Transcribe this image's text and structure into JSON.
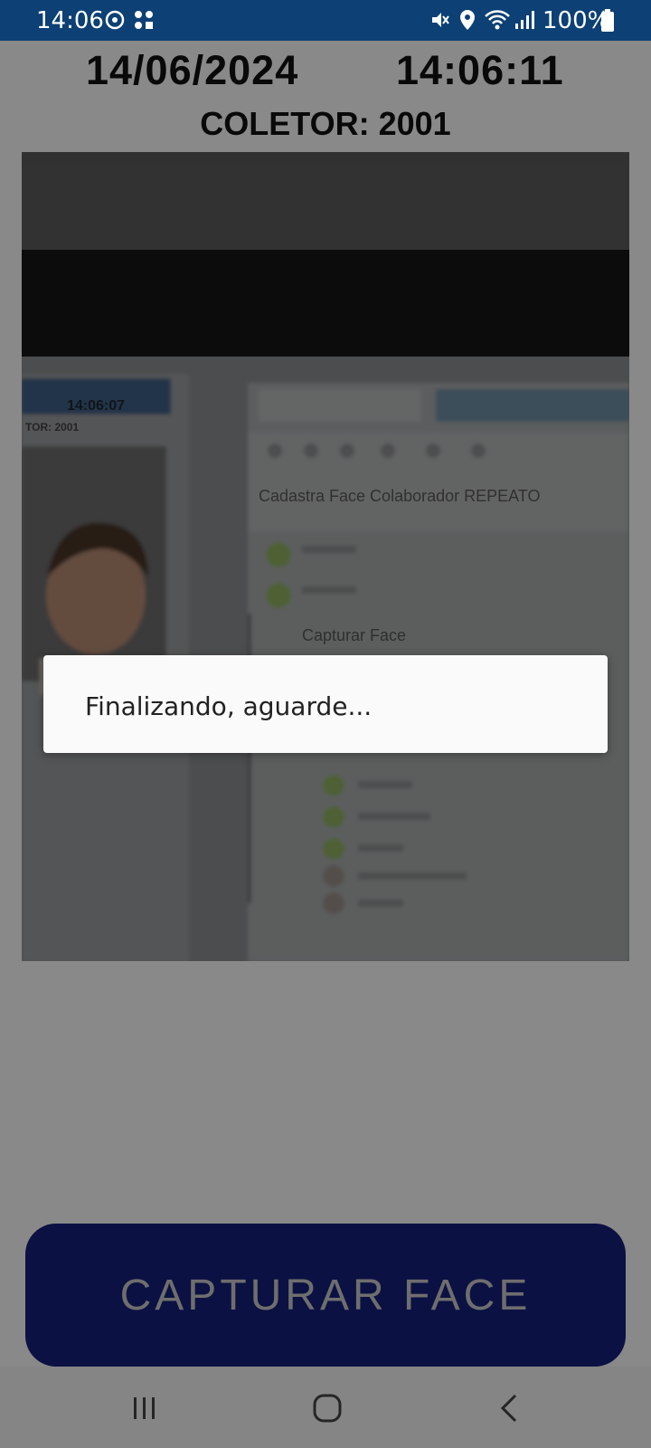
{
  "status_bar": {
    "time": "14:06",
    "battery": "100%",
    "icons": [
      "sync-icon",
      "apps-icon",
      "mute-icon",
      "location-icon",
      "wifi-icon",
      "signal-icon",
      "battery-icon"
    ]
  },
  "header": {
    "date": "14/06/2024",
    "time": "14:06:11",
    "collector": "COLETOR: 2001"
  },
  "camera_screen": {
    "mini_time": "14:06:07",
    "mini_collector_fragment": "TOR: 2001",
    "page_title": "Cadastra Face Colaborador REPEATO",
    "section_label": "Capturar Face"
  },
  "capture_button": {
    "label": "CAPTURAR FACE"
  },
  "dialog": {
    "message": "Finalizando, aguarde..."
  },
  "colors": {
    "status_bar": "#0d4074",
    "button": "#16207a",
    "button_text": "#c8c8c8"
  }
}
